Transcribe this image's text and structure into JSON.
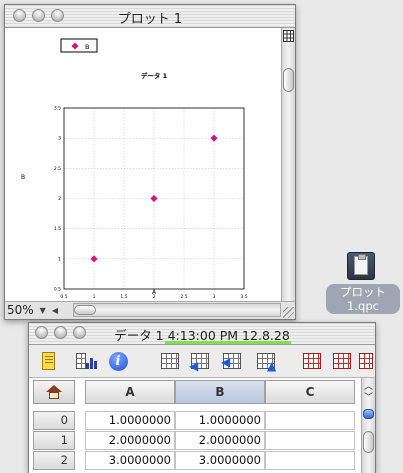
{
  "plot_window": {
    "title": "プロット 1",
    "zoom": "50%",
    "plot_title": "データ 1",
    "legend_label": "B",
    "x_axis_label": "A",
    "y_axis_label": "B"
  },
  "chart_data": {
    "type": "scatter",
    "title": "データ 1",
    "xlabel": "A",
    "ylabel": "B",
    "xlim": [
      0.5,
      3.5
    ],
    "ylim": [
      0.5,
      3.5
    ],
    "x_ticks": [
      "0.5",
      "1",
      "1.5",
      "2",
      "2.5",
      "3",
      "3.5"
    ],
    "y_ticks": [
      "0.5",
      "1",
      "1.5",
      "2",
      "2.5",
      "3",
      "3.5"
    ],
    "grid": true,
    "legend_placement": "top-left",
    "series": [
      {
        "name": "B",
        "color": "#d0177a",
        "marker": "diamond",
        "x": [
          1,
          2,
          3
        ],
        "y": [
          1,
          2,
          3
        ]
      }
    ]
  },
  "desktop": {
    "file_label_line1": "プロット",
    "file_label_line2": "1.qpc"
  },
  "data_window": {
    "title": "データ 1 4:13:00 PM 12.8.28",
    "columns": [
      "A",
      "B",
      "C"
    ],
    "rows": [
      {
        "index": "0",
        "cells": [
          "1.0000000",
          "1.0000000",
          ""
        ]
      },
      {
        "index": "1",
        "cells": [
          "2.0000000",
          "2.0000000",
          ""
        ]
      },
      {
        "index": "2",
        "cells": [
          "3.0000000",
          "3.0000000",
          ""
        ]
      }
    ],
    "toolbar": [
      "note-icon",
      "statistics-icon",
      "info-icon",
      "insert-column-icon",
      "insert-column-left-icon",
      "insert-row-icon",
      "insert-row-below-icon",
      "delete-column-icon",
      "delete-row-icon",
      "table-properties-icon"
    ],
    "accent_progress_color": "#7ee34a"
  }
}
